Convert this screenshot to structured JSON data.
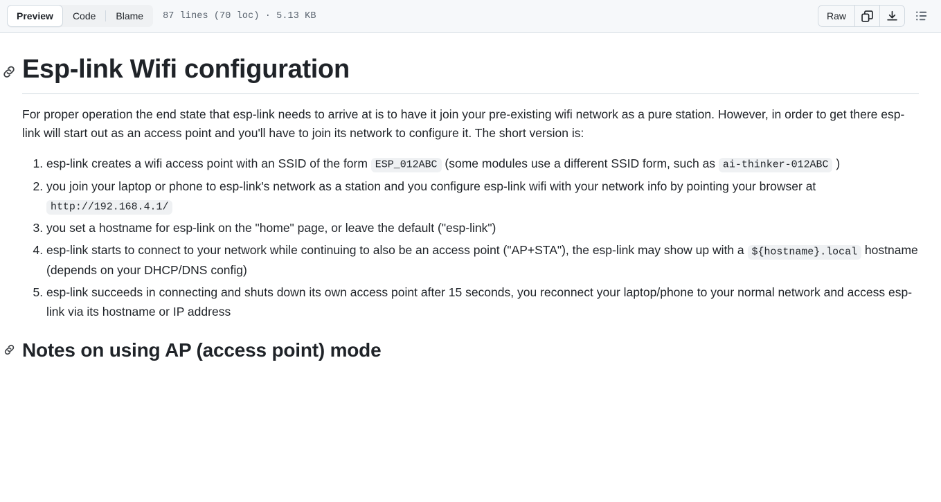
{
  "header": {
    "tabs": [
      {
        "label": "Preview",
        "selected": true
      },
      {
        "label": "Code",
        "selected": false
      },
      {
        "label": "Blame",
        "selected": false
      }
    ],
    "file_meta": "87 lines (70 loc) · 5.13 KB",
    "raw_label": "Raw",
    "copy_icon": "copy-icon",
    "download_icon": "download-icon",
    "outline_icon": "outline-list-icon"
  },
  "document": {
    "h1": "Esp-link Wifi configuration",
    "anchor_icon": "link-anchor-icon",
    "intro": "For proper operation the end state that esp-link needs to arrive at is to have it join your pre-existing wifi network as a pure station. However, in order to get there esp-link will start out as an access point and you'll have to join its network to configure it. The short version is:",
    "steps": [
      {
        "parts": [
          {
            "t": "text",
            "v": "esp-link creates a wifi access point with an SSID of the form "
          },
          {
            "t": "code",
            "v": "ESP_012ABC"
          },
          {
            "t": "text",
            "v": " (some modules use a different SSID form, such as "
          },
          {
            "t": "code",
            "v": "ai-thinker-012ABC"
          },
          {
            "t": "text",
            "v": " )"
          }
        ]
      },
      {
        "parts": [
          {
            "t": "text",
            "v": "you join your laptop or phone to esp-link's network as a station and you configure esp-link wifi with your network info by pointing your browser at "
          },
          {
            "t": "code",
            "v": "http://192.168.4.1/"
          }
        ]
      },
      {
        "parts": [
          {
            "t": "text",
            "v": "you set a hostname for esp-link on the \"home\" page, or leave the default (\"esp-link\")"
          }
        ]
      },
      {
        "parts": [
          {
            "t": "text",
            "v": "esp-link starts to connect to your network while continuing to also be an access point (\"AP+STA\"), the esp-link may show up with a "
          },
          {
            "t": "code",
            "v": "${hostname}.local"
          },
          {
            "t": "text",
            "v": " hostname (depends on your DHCP/DNS config)"
          }
        ]
      },
      {
        "parts": [
          {
            "t": "text",
            "v": "esp-link succeeds in connecting and shuts down its own access point after 15 seconds, you reconnect your laptop/phone to your normal network and access esp-link via its hostname or IP address"
          }
        ]
      }
    ],
    "h2": "Notes on using AP (access point) mode"
  },
  "colors": {
    "header_bg": "#f6f8fa",
    "border": "#d1d9e0",
    "text": "#1f2328",
    "muted": "#59636e",
    "code_bg": "#eff1f3",
    "segmented_bg": "#eff1f3"
  }
}
